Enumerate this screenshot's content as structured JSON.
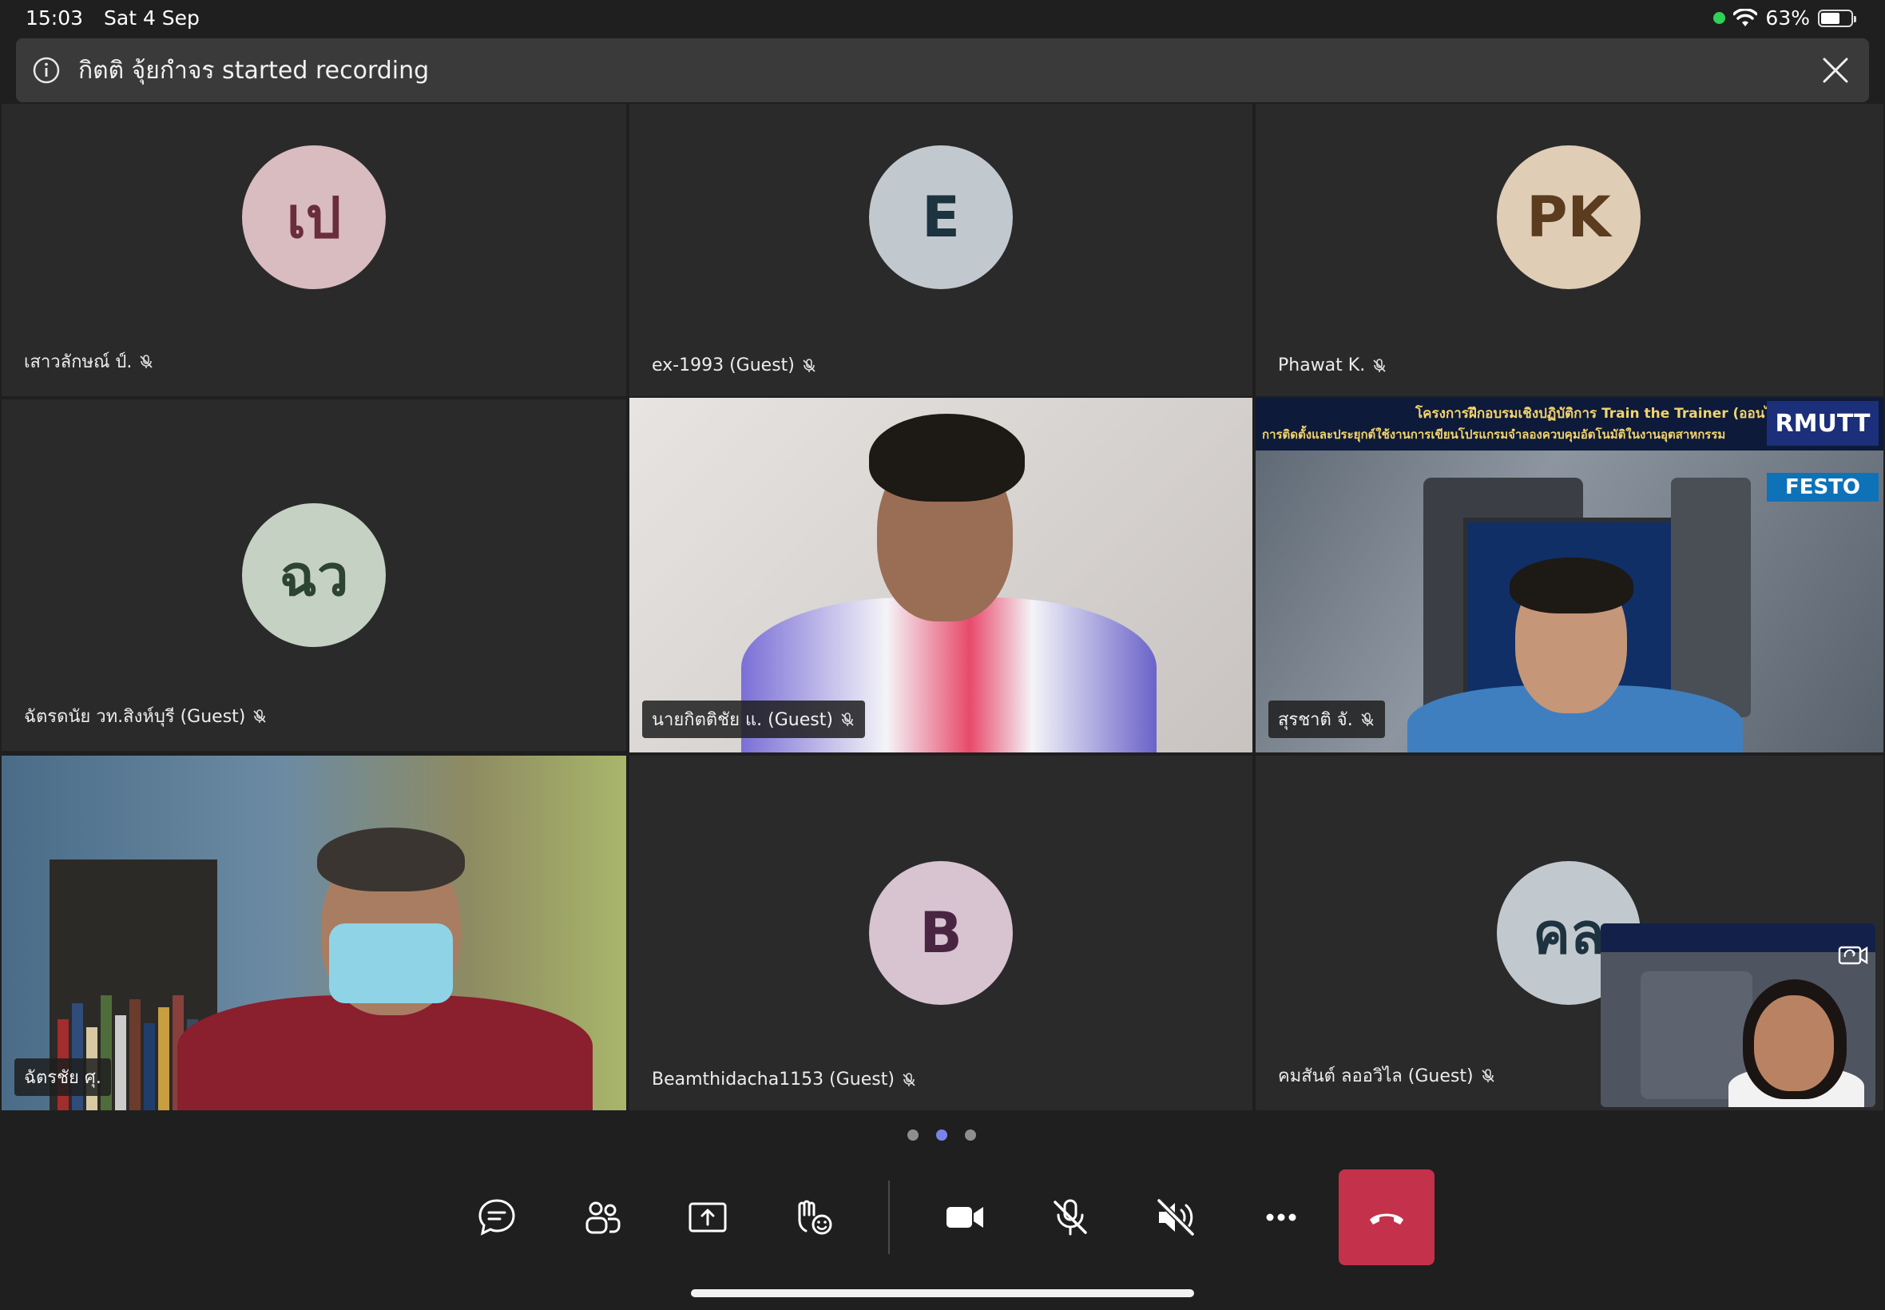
{
  "status_bar": {
    "time": "15:03",
    "date": "Sat 4 Sep",
    "battery": "63%",
    "battery_level": 0.63
  },
  "banner": {
    "icon": "info-icon",
    "text": "กิตติ จุ้ยกำจร started recording",
    "close_icon": "close-icon"
  },
  "participants": [
    {
      "id": "p1",
      "initials": "เป",
      "name": "เสาวลักษณ์ ป์.",
      "avatar_bg": "#d9bcbf",
      "avatar_fg": "#6a2d3a",
      "muted": true
    },
    {
      "id": "p2",
      "initials": "E",
      "name": "ex-1993 (Guest)",
      "avatar_bg": "#c2c9ce",
      "avatar_fg": "#1e3340",
      "muted": true
    },
    {
      "id": "p3",
      "initials": "PK",
      "name": "Phawat K.",
      "avatar_bg": "#e0cdb6",
      "avatar_fg": "#5b3c1f",
      "muted": true
    },
    {
      "id": "p4",
      "initials": "ฉว",
      "name": "ฉัตรดนัย วท.สิงห์บุรี (Guest)",
      "avatar_bg": "#c5d1c3",
      "avatar_fg": "#2c4430",
      "muted": true
    },
    {
      "id": "p5",
      "name": "นายกิตติชัย แ. (Guest)",
      "video": true,
      "muted": true
    },
    {
      "id": "p6",
      "name": "สุรชาติ จั.",
      "video": true,
      "muted": true
    },
    {
      "id": "p7",
      "name": "ฉัตรชัย ศุ.",
      "video": true,
      "muted": false
    },
    {
      "id": "p8",
      "initials": "B",
      "name": "Beamthidacha1153 (Guest)",
      "avatar_bg": "#d8c3d1",
      "avatar_fg": "#4a2541",
      "muted": true
    },
    {
      "id": "p9",
      "initials": "คล",
      "name": "คมสันต์ ลออวิไล (Guest)",
      "avatar_bg": "#c2c9ce",
      "avatar_fg": "#1e3340",
      "muted": true
    }
  ],
  "slide": {
    "line1": "โครงการฝึกอบรมเชิงปฏิบัติการ Train the Trainer (ออนไลน์)",
    "line2": "การติดตั้งและประยุกต์ใช้งานการเขียนโปรแกรมจำลองควบคุมอัตโนมัติในงานอุตสาหกรรม",
    "logo": "RMUTT",
    "brand": "FESTO"
  },
  "pagination": {
    "pages": 3,
    "current": 2
  },
  "toolbar": {
    "buttons": [
      {
        "name": "chat-button",
        "icon": "chat-icon"
      },
      {
        "name": "participants-button",
        "icon": "people-icon"
      },
      {
        "name": "share-button",
        "icon": "share-tray-icon"
      },
      {
        "name": "reactions-button",
        "icon": "raise-hand-icon"
      },
      {
        "name": "camera-button",
        "icon": "video-camera-icon"
      },
      {
        "name": "mic-button",
        "icon": "mic-off-icon"
      },
      {
        "name": "speaker-button",
        "icon": "speaker-off-icon"
      },
      {
        "name": "more-button",
        "icon": "more-icon"
      },
      {
        "name": "hangup-button",
        "icon": "hangup-icon"
      }
    ],
    "colors": {
      "hangup": "#c4314b",
      "accent": "#7b83eb"
    }
  }
}
